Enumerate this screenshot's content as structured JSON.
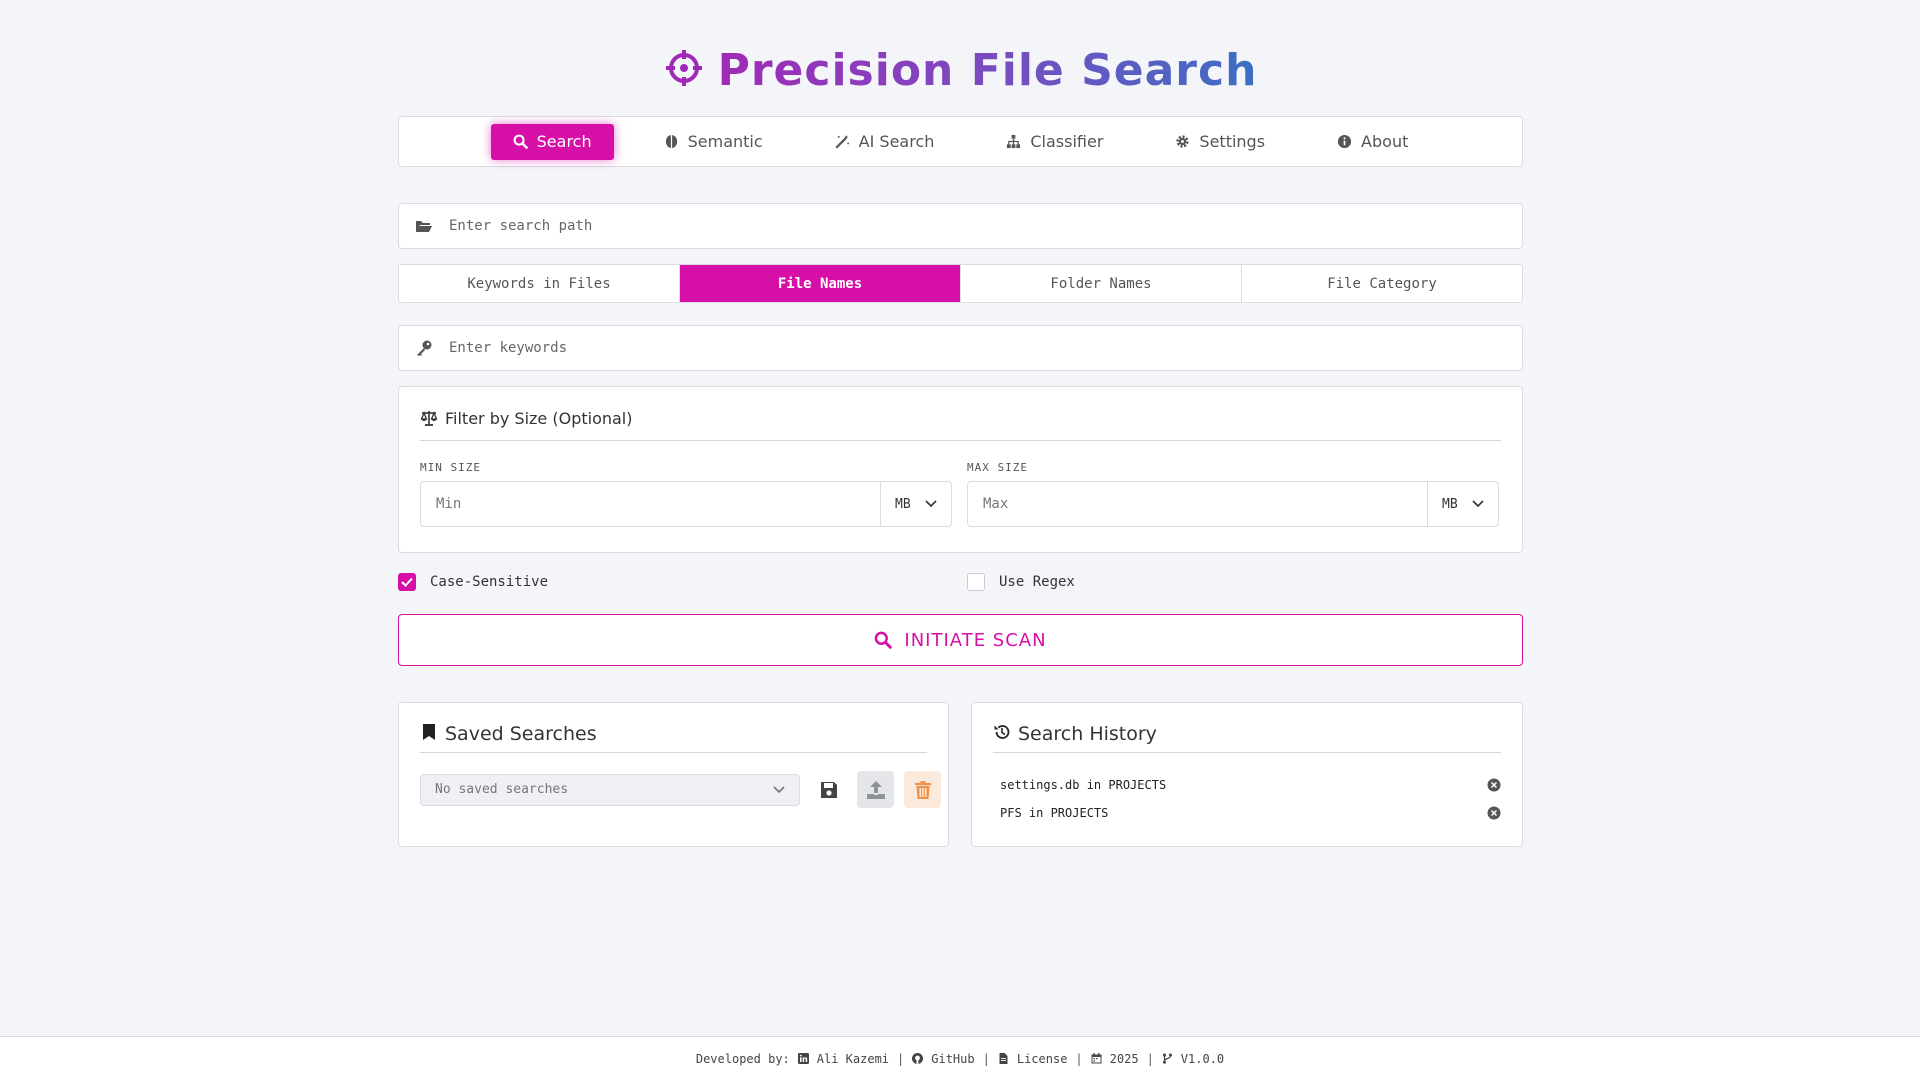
{
  "app": {
    "title": "Precision File Search",
    "brand_color": "#d60fa6"
  },
  "nav": {
    "items": [
      {
        "label": "Search",
        "icon": "search-icon",
        "active": true
      },
      {
        "label": "Semantic",
        "icon": "brain-icon"
      },
      {
        "label": "AI Search",
        "icon": "magic-wand-icon"
      },
      {
        "label": "Classifier",
        "icon": "sitemap-icon"
      },
      {
        "label": "Settings",
        "icon": "gear-icon"
      },
      {
        "label": "About",
        "icon": "info-icon"
      }
    ]
  },
  "search_path": {
    "placeholder": "Enter search path",
    "icon": "folder-open-icon"
  },
  "modes": [
    {
      "label": "Keywords in Files"
    },
    {
      "label": "File Names",
      "active": true
    },
    {
      "label": "Folder Names"
    },
    {
      "label": "File Category"
    }
  ],
  "keywords": {
    "placeholder": "Enter keywords",
    "icon": "key-icon"
  },
  "size_filter": {
    "title": "Filter by Size (Optional)",
    "min": {
      "label": "MIN SIZE",
      "placeholder": "Min",
      "unit": "MB"
    },
    "max": {
      "label": "MAX SIZE",
      "placeholder": "Max",
      "unit": "MB"
    }
  },
  "options": {
    "case_sensitive": {
      "label": "Case-Sensitive",
      "checked": true
    },
    "regex": {
      "label": "Use Regex",
      "checked": false
    }
  },
  "scan_button": {
    "label": "INITIATE SCAN"
  },
  "saved": {
    "title": "Saved Searches",
    "select_value": "No saved searches"
  },
  "history": {
    "title": "Search History",
    "items": [
      {
        "text": "settings.db in PROJECTS"
      },
      {
        "text": "PFS in PROJECTS"
      }
    ]
  },
  "footer": {
    "developed_by": "Developed by:",
    "author": "Ali Kazemi",
    "github": "GitHub",
    "license": "License",
    "year": "2025",
    "version": "V1.0.0",
    "separator": "|"
  }
}
